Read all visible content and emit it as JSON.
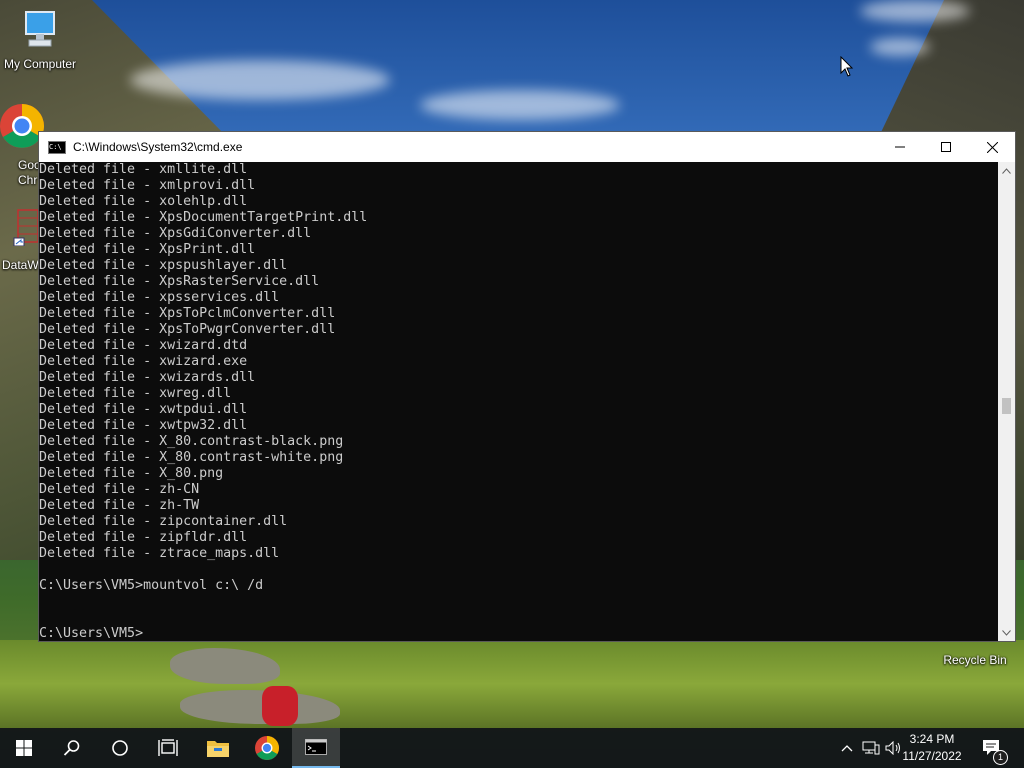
{
  "desktop": {
    "icons": [
      {
        "label": "My Computer"
      },
      {
        "label": "Goo Chr"
      },
      {
        "label": "DataW"
      },
      {
        "label": "Recycle Bin"
      }
    ]
  },
  "cmd_window": {
    "title": "C:\\Windows\\System32\\cmd.exe",
    "minimize": "—",
    "maximize": "☐",
    "close": "✕",
    "lines": [
      "Deleted file - xmllite.dll",
      "Deleted file - xmlprovi.dll",
      "Deleted file - xolehlp.dll",
      "Deleted file - XpsDocumentTargetPrint.dll",
      "Deleted file - XpsGdiConverter.dll",
      "Deleted file - XpsPrint.dll",
      "Deleted file - xpspushlayer.dll",
      "Deleted file - XpsRasterService.dll",
      "Deleted file - xpsservices.dll",
      "Deleted file - XpsToPclmConverter.dll",
      "Deleted file - XpsToPwgrConverter.dll",
      "Deleted file - xwizard.dtd",
      "Deleted file - xwizard.exe",
      "Deleted file - xwizards.dll",
      "Deleted file - xwreg.dll",
      "Deleted file - xwtpdui.dll",
      "Deleted file - xwtpw32.dll",
      "Deleted file - X_80.contrast-black.png",
      "Deleted file - X_80.contrast-white.png",
      "Deleted file - X_80.png",
      "Deleted file - zh-CN",
      "Deleted file - zh-TW",
      "Deleted file - zipcontainer.dll",
      "Deleted file - zipfldr.dll",
      "Deleted file - ztrace_maps.dll",
      "",
      "C:\\Users\\VM5>mountvol c:\\ /d",
      "",
      "",
      "C:\\Users\\VM5>"
    ]
  },
  "taskbar": {
    "clock_time": "3:24 PM",
    "clock_date": "11/27/2022",
    "notification_count": "1",
    "accent": "#76b9ed"
  }
}
